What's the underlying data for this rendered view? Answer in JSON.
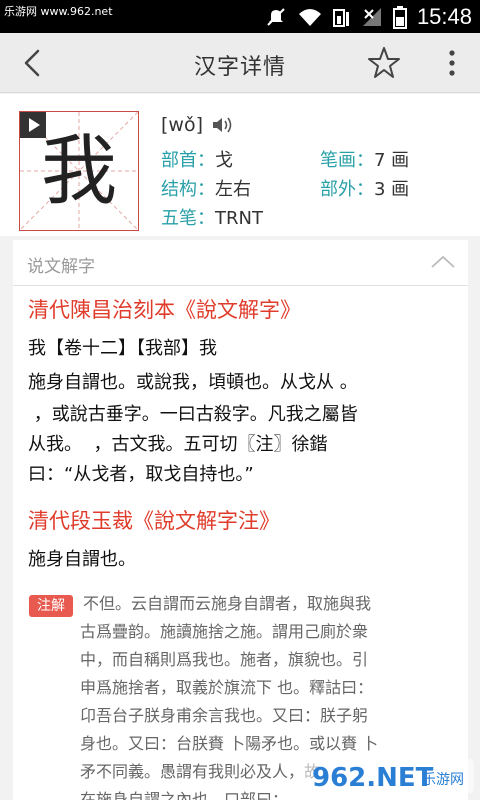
{
  "status_bar": {
    "site": "乐游网 www.962.net",
    "time": "15:48"
  },
  "app_bar": {
    "title": "汉字详情"
  },
  "character": {
    "glyph": "我",
    "pinyin": "[wǒ]",
    "rows": [
      {
        "label": "部首：",
        "value": "戈"
      },
      {
        "label": "笔画：",
        "value": "7 画"
      },
      {
        "label": "结构：",
        "value": "左右"
      },
      {
        "label": "部外：",
        "value": "3 画"
      },
      {
        "label": "五笔：",
        "value": "TRNT"
      }
    ]
  },
  "shuowen": {
    "header": "说文解字",
    "source1_title": "清代陳昌治刻本《說文解字》",
    "source1_lines": [
      "我【卷十二】【我部】我",
      "施身自謂也。或說我，頃頓也。从戈从 。",
      " ，或說古垂字。一曰古殺字。凡我之屬皆",
      "从我。  ，古文我。五可切〖注〗徐鍇",
      "曰：“从戈者，取戈自持也。”"
    ],
    "source2_title": "清代段玉裁《說文解字注》",
    "source2_line": "施身自謂也。",
    "note_tag": "注解",
    "note_lines": [
      "不但。云自謂而云施身自謂者，取施與我",
      "古爲疊韵。施讀施捨之施。謂用己廁於衆",
      "中，而自稱則爲我也。施者，旗貌也。引",
      "申爲施捨者，取義於旗流下 也。釋詁曰：",
      "卬吾台子朕身甫余言我也。又曰：朕子躬",
      "身也。又曰：台朕賚 卜陽矛也。或以賚 卜",
      "矛不同義。愚謂有我則必及人，故",
      "在施身自謂之內也。口部曰："
    ]
  },
  "watermark": {
    "text": "962.NET",
    "sub": "乐游网"
  }
}
